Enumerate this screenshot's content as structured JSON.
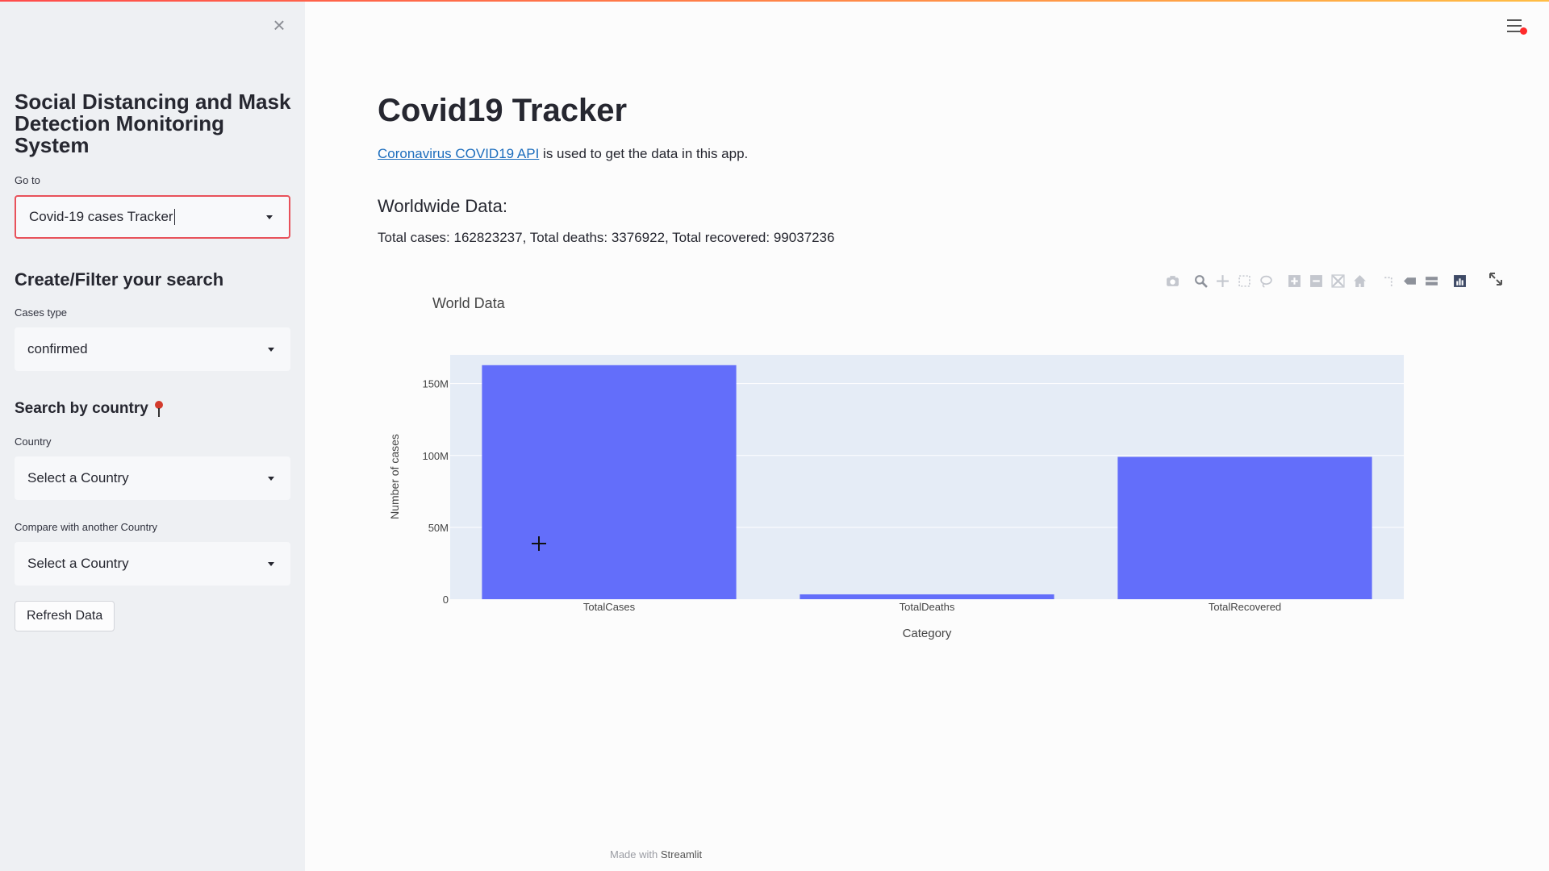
{
  "sidebar": {
    "title": "Social Distancing and Mask Detection Monitoring System",
    "goto_label": "Go to",
    "goto_value": "Covid-19 cases Tracker",
    "filter_heading": "Create/Filter your search",
    "cases_type_label": "Cases type",
    "cases_type_value": "confirmed",
    "search_country_heading": "Search by country",
    "country_label": "Country",
    "country_value": "Select a Country",
    "compare_label": "Compare with another Country",
    "compare_value": "Select a Country",
    "refresh_label": "Refresh Data"
  },
  "main": {
    "title": "Covid19 Tracker",
    "intro_link": "Coronavirus COVID19 API",
    "intro_rest": " is used to get the data in this app.",
    "worldwide_heading": "Worldwide Data:",
    "worldwide_stats": "Total cases: 162823237, Total deaths: 3376922, Total recovered: 99037236"
  },
  "footer": {
    "prefix": "Made with ",
    "brand": "Streamlit"
  },
  "colors": {
    "bar": "#636efa",
    "plot_bg": "#e5ecf6",
    "accent": "#ff4b4b"
  },
  "modebar_icons": [
    "camera-icon",
    "zoom-icon",
    "pan-icon",
    "box-select-icon",
    "lasso-select-icon",
    "zoom-in-icon",
    "zoom-out-icon",
    "autoscale-icon",
    "reset-axes-icon",
    "spike-lines-icon",
    "hover-closest-icon",
    "hover-compare-icon",
    "plotly-logo-icon"
  ],
  "chart_data": {
    "type": "bar",
    "title": "World Data",
    "categories": [
      "TotalCases",
      "TotalDeaths",
      "TotalRecovered"
    ],
    "values": [
      162823237,
      3376922,
      99037236
    ],
    "xlabel": "Category",
    "ylabel": "Number of cases",
    "ylim": [
      0,
      170000000
    ],
    "yticks": [
      0,
      50000000,
      100000000,
      150000000
    ],
    "ytick_labels": [
      "0",
      "50M",
      "100M",
      "150M"
    ],
    "grid": true,
    "legend": false
  }
}
